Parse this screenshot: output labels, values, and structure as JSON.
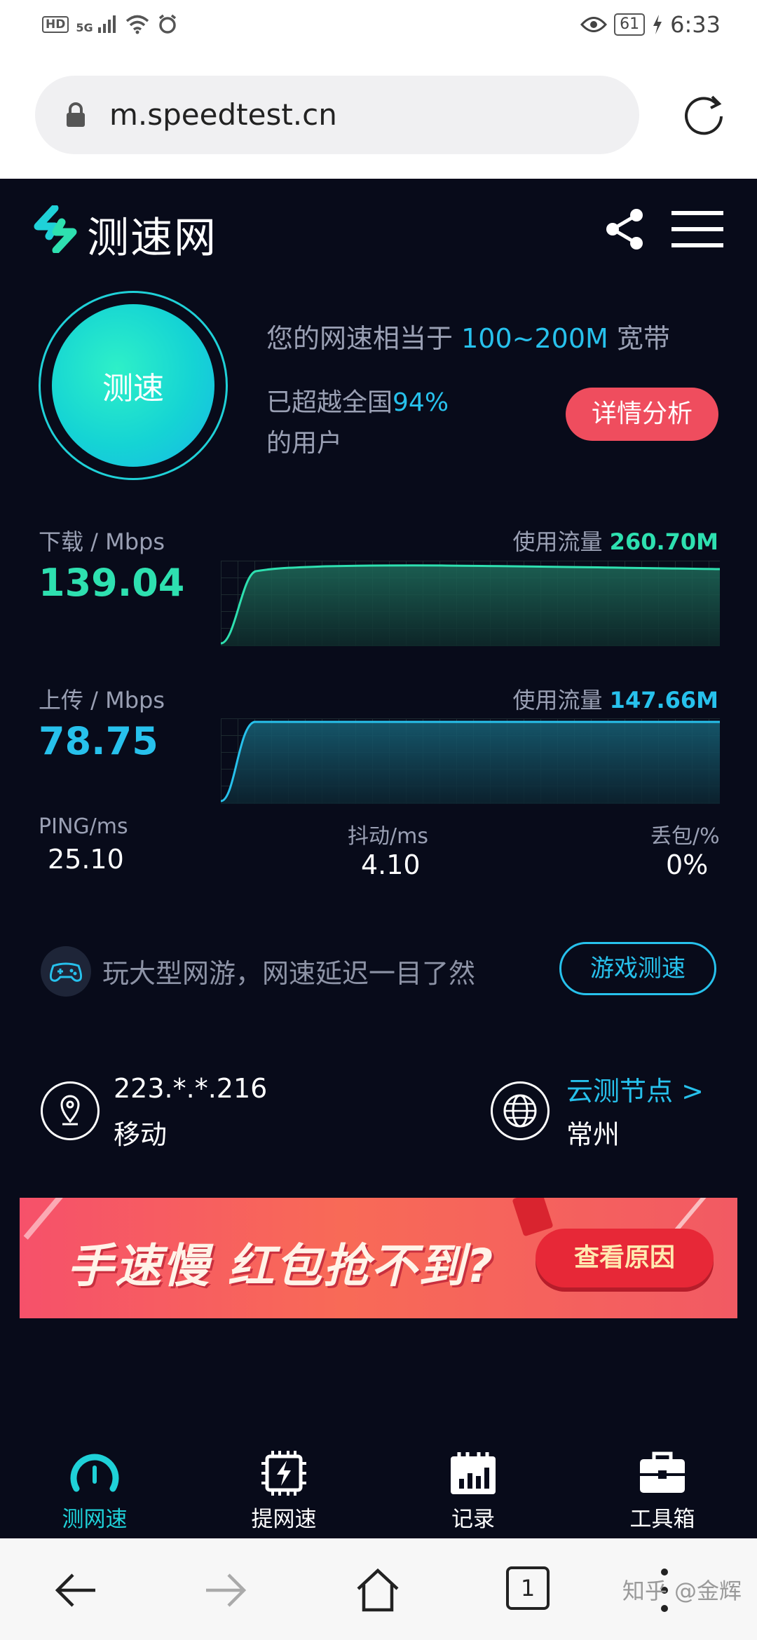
{
  "status_bar": {
    "hd": "HD",
    "network": "5G",
    "battery": "61",
    "time": "6:33"
  },
  "browser": {
    "url": "m.speedtest.cn",
    "tab_count": "1",
    "watermark": "知乎 @金辉"
  },
  "header": {
    "title": "测速网"
  },
  "hero": {
    "button_label": "测速",
    "equiv_prefix": "您的网速相当于",
    "equiv_value": "100~200M",
    "equiv_suffix": "宽带",
    "beat_prefix": "已超越全国",
    "beat_value": "94%",
    "beat_suffix": "的用户",
    "detail_button": "详情分析"
  },
  "download": {
    "label": "下载 / Mbps",
    "value": "139.04",
    "usage_label": "使用流量",
    "usage_value": "260.70M",
    "color": "#2ee0b0"
  },
  "upload": {
    "label": "上传 / Mbps",
    "value": "78.75",
    "usage_label": "使用流量",
    "usage_value": "147.66M",
    "color": "#27c1ec"
  },
  "metrics": {
    "ping_label": "PING/ms",
    "ping_value": "25.10",
    "jitter_label": "抖动/ms",
    "jitter_value": "4.10",
    "loss_label": "丢包/%",
    "loss_value": "0%"
  },
  "game": {
    "text": "玩大型网游，网速延迟一目了然",
    "button": "游戏测速"
  },
  "network_info": {
    "ip": "223.*.*.216",
    "isp": "移动",
    "node_link": "云测节点 >",
    "node_city": "常州"
  },
  "banner": {
    "text": "手速慢 红包抢不到?",
    "button": "查看原因"
  },
  "nav": {
    "items": [
      {
        "label": "测网速",
        "icon": "speedometer-icon"
      },
      {
        "label": "提网速",
        "icon": "boost-chip-icon"
      },
      {
        "label": "记录",
        "icon": "records-icon"
      },
      {
        "label": "工具箱",
        "icon": "toolbox-icon"
      }
    ]
  }
}
